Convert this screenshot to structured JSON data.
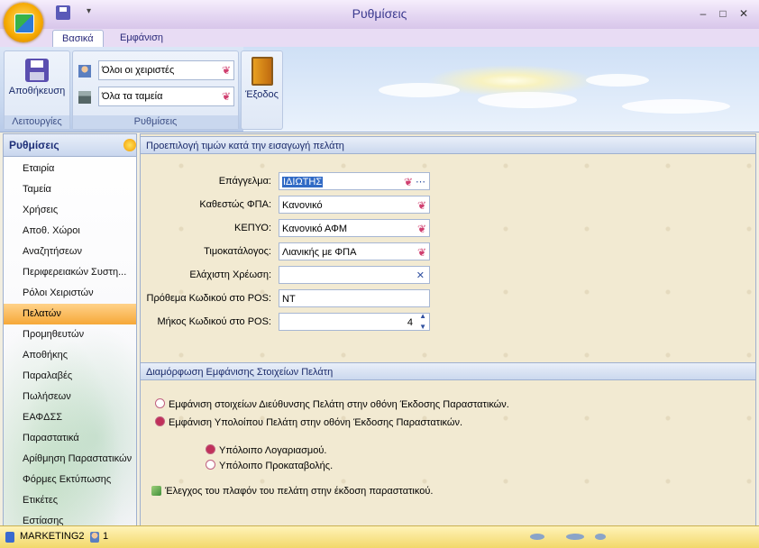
{
  "window": {
    "title": "Ρυθμίσεις"
  },
  "qat": {
    "save_icon": "save-icon",
    "dropdown_glyph": "▾"
  },
  "window_controls": {
    "minimize": "–",
    "maximize": "□",
    "close": "✕"
  },
  "tabs": [
    {
      "label": "Βασικά"
    },
    {
      "label": "Εμφάνιση"
    }
  ],
  "ribbon": {
    "groups": {
      "actions": {
        "label": "Λειτουργίες",
        "save_label": "Αποθήκευση"
      },
      "settings": {
        "label": "Ρυθμίσεις",
        "users_value": "Όλοι οι χειριστές",
        "cashboxes_value": "Όλα τα ταμεία"
      },
      "exit": {
        "label": "Έξοδος"
      }
    }
  },
  "sidebar": {
    "title": "Ρυθμίσεις",
    "items": [
      {
        "label": "Εταιρία"
      },
      {
        "label": "Ταμεία"
      },
      {
        "label": "Χρήσεις"
      },
      {
        "label": "Αποθ. Χώροι"
      },
      {
        "label": "Αναζητήσεων"
      },
      {
        "label": "Περιφερειακών Συστη..."
      },
      {
        "label": "Ρόλοι Χειριστών"
      },
      {
        "label": "Πελατών"
      },
      {
        "label": "Προμηθευτών"
      },
      {
        "label": "Αποθήκης"
      },
      {
        "label": "Παραλαβές"
      },
      {
        "label": "Πωλήσεων"
      },
      {
        "label": "ΕΑΦΔΣΣ"
      },
      {
        "label": "Παραστατικά"
      },
      {
        "label": "Αρίθμηση Παραστατικών"
      },
      {
        "label": "Φόρμες Εκτύπωσης"
      },
      {
        "label": "Ετικέτες"
      },
      {
        "label": "Εστίασης"
      }
    ],
    "selected": "Πελατών"
  },
  "section1": {
    "title": "Προεπιλογή τιμών κατά την εισαγωγή πελάτη",
    "fields": {
      "profession": {
        "label": "Επάγγελμα:",
        "value": "ΙΔΙΩΤΗΣ"
      },
      "vat_status": {
        "label": "Καθεστώς ΦΠΑ:",
        "value": "Κανονικό"
      },
      "kepyo": {
        "label": "ΚΕΠΥΟ:",
        "value": "Κανονικό ΑΦΜ"
      },
      "pricelist": {
        "label": "Τιμοκατάλογος:",
        "value": "Λιανικής με ΦΠΑ"
      },
      "min_charge": {
        "label": "Ελάχιστη Χρέωση:",
        "value": ""
      },
      "pos_prefix": {
        "label": "Πρόθεμα Κωδικού στο POS:",
        "value": "ΝΤ"
      },
      "pos_length": {
        "label": "Μήκος Κωδικού στο POS:",
        "value": "4"
      }
    }
  },
  "section2": {
    "title": "Διαμόρφωση Εμφάνισης Στοιχείων Πελάτη",
    "options": {
      "show_address": "Εμφάνιση στοιχείων Διεύθυνσης Πελάτη στην οθόνη Έκδοσης Παραστατικών.",
      "show_balance": "Εμφάνιση Υπολοίπου Πελάτη στην οθόνη Έκδοσης Παραστατικών.",
      "account_balance": "Υπόλοιπο Λογαριασμού.",
      "prepayment_balance": "Υπόλοιπο Προκαταβολής.",
      "credit_limit_check": "Έλεγχος του πλαφόν του πελάτη στην έκδοση παραστατικού."
    }
  },
  "status": {
    "user": "MARKETING2",
    "sessions": "1"
  }
}
